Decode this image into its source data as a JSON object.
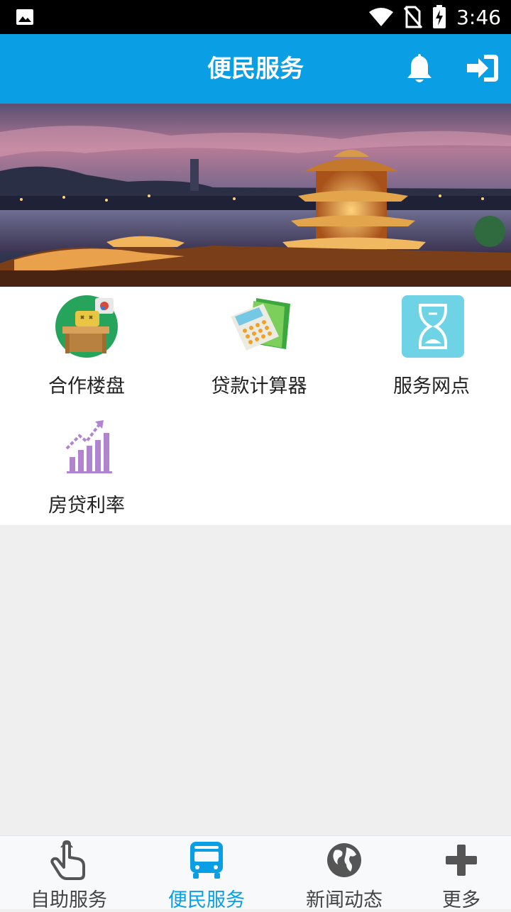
{
  "status_bar": {
    "time": "3:46"
  },
  "app_bar": {
    "title": "便民服务"
  },
  "services": [
    {
      "label": "合作楼盘",
      "icon": "building-desk-icon"
    },
    {
      "label": "贷款计算器",
      "icon": "calculator-icon"
    },
    {
      "label": "服务网点",
      "icon": "hourglass-icon"
    },
    {
      "label": "房贷利率",
      "icon": "growth-chart-icon"
    }
  ],
  "tabs": [
    {
      "label": "自助服务",
      "icon": "hand-pointer-icon",
      "active": false
    },
    {
      "label": "便民服务",
      "icon": "bus-icon",
      "active": true
    },
    {
      "label": "新闻动态",
      "icon": "globe-icon",
      "active": false
    },
    {
      "label": "更多",
      "icon": "plus-icon",
      "active": false
    }
  ],
  "colors": {
    "primary": "#0a9fe4",
    "background": "#efefef",
    "tab_inactive": "#555555"
  }
}
